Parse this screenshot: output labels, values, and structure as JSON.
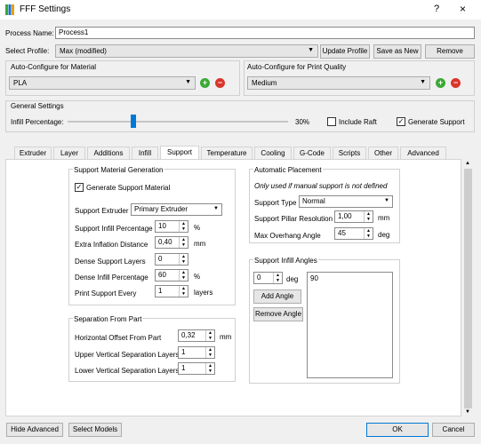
{
  "window": {
    "title": "FFF Settings",
    "help": "?",
    "close": "×"
  },
  "process": {
    "label": "Process Name:",
    "value": "Process1"
  },
  "profile": {
    "label": "Select Profile:",
    "value": "Max (modified)",
    "update": "Update Profile",
    "save_as_new": "Save as New",
    "remove": "Remove"
  },
  "material": {
    "label": "Auto-Configure for Material",
    "value": "PLA"
  },
  "quality": {
    "label": "Auto-Configure for Print Quality",
    "value": "Medium"
  },
  "general": {
    "label": "General Settings",
    "infill_label": "Infill Percentage:",
    "infill_value": "30%",
    "infill_fraction": 0.3,
    "raft_label": "Include Raft",
    "raft_checked": false,
    "support_label": "Generate Support",
    "support_checked": true
  },
  "tabs": [
    "Extruder",
    "Layer",
    "Additions",
    "Infill",
    "Support",
    "Temperature",
    "Cooling",
    "G-Code",
    "Scripts",
    "Other",
    "Advanced"
  ],
  "active_tab": "Support",
  "support_gen": {
    "title": "Support Material Generation",
    "generate_label": "Generate Support Material",
    "extruder_label": "Support Extruder",
    "extruder_value": "Primary Extruder",
    "infill_pct_label": "Support Infill Percentage",
    "infill_pct_value": "10",
    "infill_pct_unit": "%",
    "inflation_label": "Extra Inflation Distance",
    "inflation_value": "0,40",
    "inflation_unit": "mm",
    "dense_layers_label": "Dense Support Layers",
    "dense_layers_value": "0",
    "dense_infill_label": "Dense Infill Percentage",
    "dense_infill_value": "60",
    "dense_infill_unit": "%",
    "print_every_label": "Print Support Every",
    "print_every_value": "1",
    "print_every_unit": "layers"
  },
  "separation": {
    "title": "Separation From Part",
    "horiz_label": "Horizontal Offset From Part",
    "horiz_value": "0,32",
    "horiz_unit": "mm",
    "upper_label": "Upper Vertical Separation Layers",
    "upper_value": "1",
    "lower_label": "Lower Vertical Separation Layers",
    "lower_value": "1"
  },
  "auto_place": {
    "title": "Automatic Placement",
    "note": "Only used if manual support is not defined",
    "type_label": "Support Type",
    "type_value": "Normal",
    "pillar_label": "Support Pillar Resolution",
    "pillar_value": "1,00",
    "pillar_unit": "mm",
    "overhang_label": "Max Overhang Angle",
    "overhang_value": "45",
    "overhang_unit": "deg"
  },
  "infill_angles": {
    "title": "Support Infill Angles",
    "angle_value": "0",
    "angle_unit": "deg",
    "add": "Add Angle",
    "remove": "Remove Angle",
    "list": [
      "90"
    ]
  },
  "footer": {
    "hide_advanced": "Hide Advanced",
    "select_models": "Select Models",
    "ok": "OK",
    "cancel": "Cancel"
  },
  "colors": {
    "accent": "#0078d7",
    "add": "#3aa935",
    "remove": "#d9362b"
  }
}
